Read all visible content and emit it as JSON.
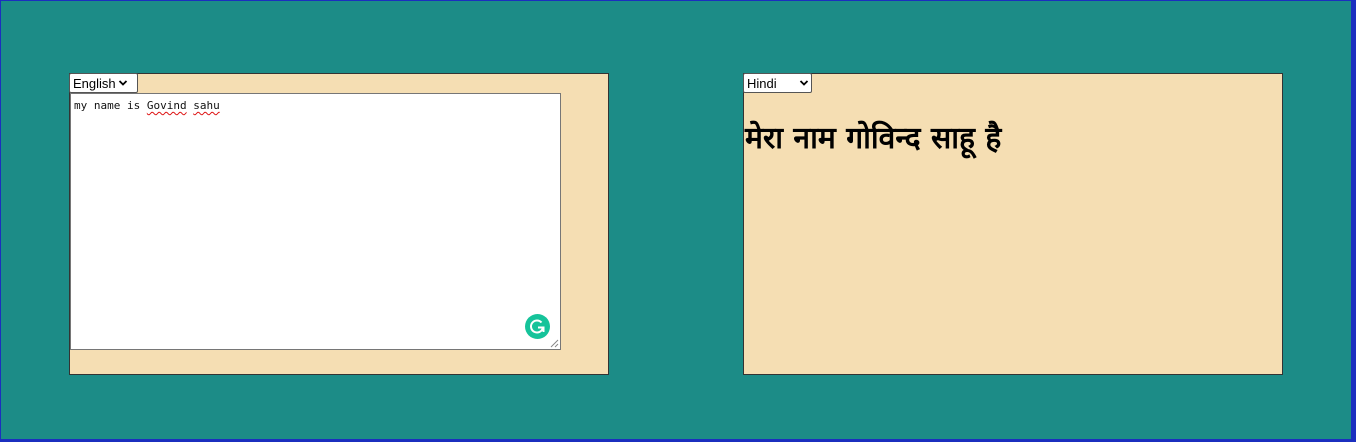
{
  "source": {
    "language_selected": "English",
    "text_value": {
      "part1": "my name is ",
      "part2": "Govind",
      "part3": " ",
      "part4": "sahu"
    },
    "assistant_icon": "grammarly-icon"
  },
  "target": {
    "language_selected": "Hindi",
    "translation": "मेरा नाम गोविन्द साहू है"
  },
  "colors": {
    "background": "#1c8c87",
    "panel": "#f5deb3",
    "assistant": "#15c39a"
  }
}
